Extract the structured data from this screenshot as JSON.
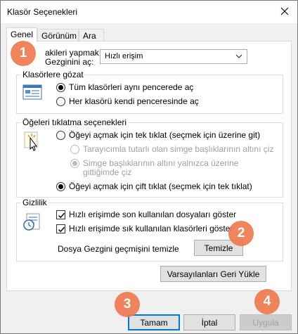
{
  "window": {
    "title": "Klasör Seçenekleri"
  },
  "tabs": [
    {
      "label": "Genel"
    },
    {
      "label": "Görünüm"
    },
    {
      "label": "Ara"
    }
  ],
  "general": {
    "open_label_line1": "akileri yapmak için",
    "open_label_line2": "Gezginini aç:",
    "open_select_value": "Hızlı erişim",
    "browse_group_title": "Klasörlere gözat",
    "browse_options": [
      {
        "label": "Tüm klasörleri aynı pencerede aç",
        "checked": true
      },
      {
        "label": "Her klasörü kendi penceresinde aç",
        "checked": false
      }
    ],
    "click_group_title": "Öğeleri tıklatma seçenekleri",
    "click_single": "Öğeyi açmak için tek tıklat (seçmek için üzerine git)",
    "underline_browser": "Tarayıcımla tutarlı olan simge başlıklarının altını çiz",
    "underline_point_line1": "Simge başlıklarının altını yalnızca üzerine",
    "underline_point_line2": "gittiğimde çiz",
    "click_double": "Öğeyi açmak için çift tıklat (seçmek için tek tıklat)",
    "privacy_group_title": "Gizlilik",
    "privacy_recent_files": "Hızlı erişimde son kullanılan dosyaları göster",
    "privacy_frequent_folders": "Hızlı erişimde sık kullanılan klasörleri göster",
    "clear_history_label": "Dosya Gezgini geçmişini temizle",
    "clear_button": "Temizle",
    "restore_defaults_button": "Varsayılanları Geri Yükle"
  },
  "footer": {
    "ok_button": "Tamam",
    "cancel_button": "İptal",
    "apply_button": "Uygula"
  },
  "badges": [
    "1",
    "2",
    "3",
    "4"
  ],
  "colors": {
    "badge": "#ef7a4f",
    "focus": "#0078d7"
  }
}
